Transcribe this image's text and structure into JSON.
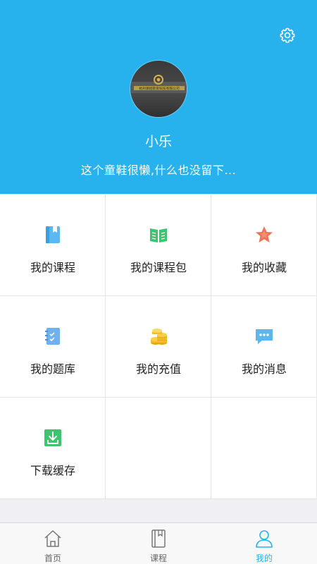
{
  "header": {
    "username": "小乐",
    "signature": "这个童鞋很懒,什么也没留下...",
    "background_color": "#27b2ee",
    "settings_icon": "gear-icon",
    "avatar_caption": "杭州课程教育科技有限公司"
  },
  "grid": {
    "items": [
      {
        "label": "我的课程",
        "icon": "book-icon"
      },
      {
        "label": "我的课程包",
        "icon": "open-book-icon"
      },
      {
        "label": "我的收藏",
        "icon": "star-icon"
      },
      {
        "label": "我的题库",
        "icon": "notebook-checklist-icon"
      },
      {
        "label": "我的充值",
        "icon": "coins-icon"
      },
      {
        "label": "我的消息",
        "icon": "chat-bubble-icon"
      },
      {
        "label": "下载缓存",
        "icon": "download-icon"
      }
    ]
  },
  "tabbar": {
    "tabs": [
      {
        "label": "首页",
        "icon": "home-icon",
        "active": false
      },
      {
        "label": "课程",
        "icon": "course-book-icon",
        "active": false
      },
      {
        "label": "我的",
        "icon": "user-icon",
        "active": true
      }
    ],
    "active_color": "#27b2ee"
  }
}
